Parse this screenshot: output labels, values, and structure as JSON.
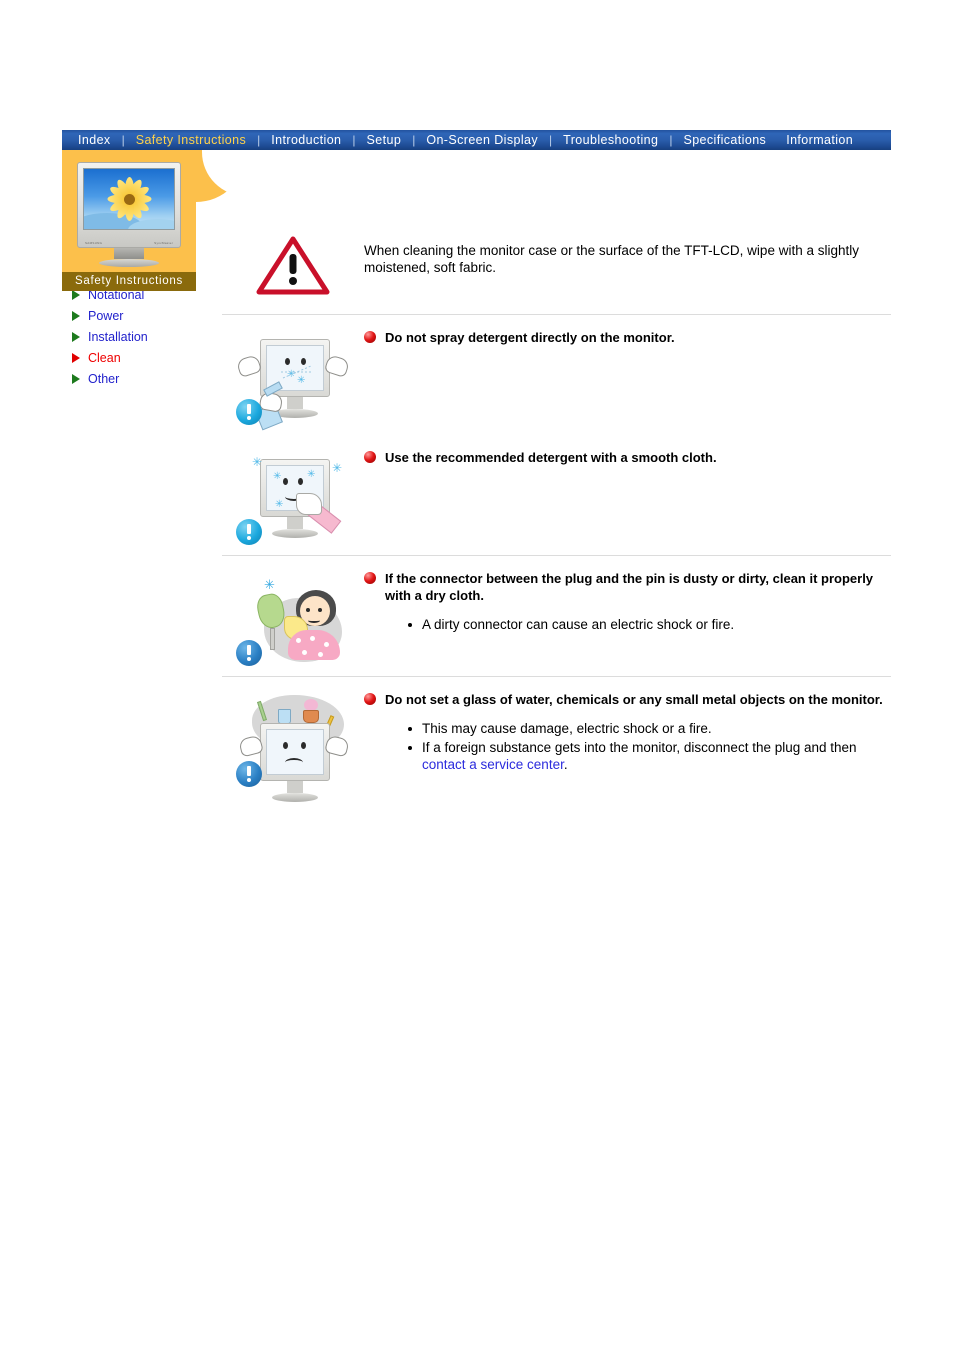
{
  "nav": {
    "separator": "|",
    "items": [
      {
        "label": "Index",
        "active": false
      },
      {
        "label": "Safety Instructions",
        "active": true
      },
      {
        "label": "Introduction",
        "active": false
      },
      {
        "label": "Setup",
        "active": false
      },
      {
        "label": "On-Screen Display",
        "active": false
      },
      {
        "label": "Troubleshooting",
        "active": false
      },
      {
        "label": "Specifications",
        "active": false
      },
      {
        "label": "Information",
        "active": false
      }
    ]
  },
  "sidebar": {
    "tab_label": "Safety Instructions",
    "monitor_brand_left": "SAMSUNG",
    "monitor_brand_right": "SyncMaster",
    "items": [
      {
        "label": "Notational",
        "active": false
      },
      {
        "label": "Power",
        "active": false
      },
      {
        "label": "Installation",
        "active": false
      },
      {
        "label": "Clean",
        "active": true
      },
      {
        "label": "Other",
        "active": false
      }
    ]
  },
  "main": {
    "intro": {
      "icon": "warning-triangle-icon",
      "text": "When cleaning the monitor case or the surface of the TFT-LCD, wipe with a slightly moistened, soft fabric."
    },
    "sections": [
      {
        "icon": "monitor-spray-illustration",
        "heading": "Do not spray detergent directly on the monitor.",
        "bullets": []
      },
      {
        "icon": "monitor-wipe-cloth-illustration",
        "heading": "Use the recommended detergent with a smooth cloth.",
        "bullets": []
      },
      {
        "icon": "person-dusting-illustration",
        "heading": "If the connector between the plug and the pin is dusty or dirty, clean it properly with a dry cloth.",
        "bullets": [
          {
            "text": "A dirty connector can cause an electric shock or fire.",
            "link": null
          }
        ]
      },
      {
        "icon": "monitor-objects-illustration",
        "heading": "Do not set a glass of water, chemicals or any small metal objects on the monitor.",
        "bullets": [
          {
            "text": "This may cause damage, electric shock or a fire.",
            "link": null
          },
          {
            "text_before": "If a foreign substance gets into the monitor, disconnect the plug and then ",
            "link": "contact a service center",
            "text_after": "."
          }
        ]
      }
    ]
  },
  "colors": {
    "nav_bar_blue": "#2a5dac",
    "nav_active_yellow": "#ffd24a",
    "sidebar_orange": "#fcc04b",
    "sidebar_tab_brown": "#8a6a0c",
    "link_blue": "#2222cc",
    "active_red": "#ee0000",
    "bullet_red": "#e11414",
    "triangle_green": "#1d7a1d",
    "badge_blue": "#1ba8de"
  }
}
